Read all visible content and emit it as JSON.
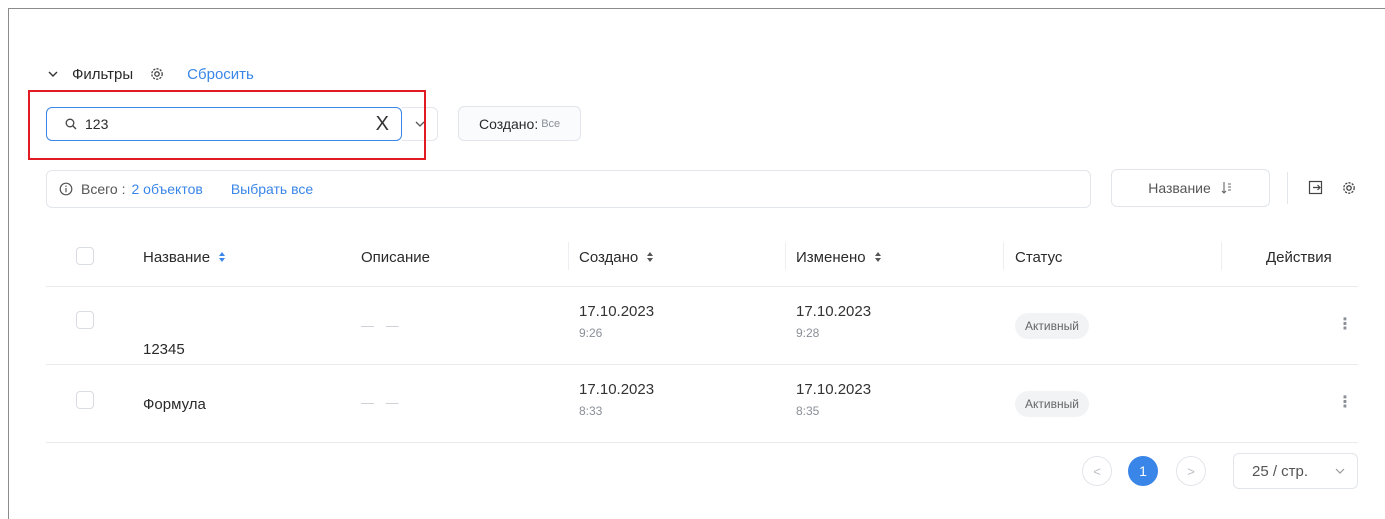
{
  "filters": {
    "title": "Фильтры",
    "reset": "Сбросить",
    "search_value": "123",
    "clear_symbol": "X",
    "created_label": "Создано:",
    "created_value": "Все"
  },
  "summary": {
    "total_label": "Всего :",
    "total_count": "2 объектов",
    "select_all": "Выбрать все",
    "sort_label": "Название"
  },
  "table": {
    "columns": [
      "Название",
      "Описание",
      "Создано",
      "Изменено",
      "Статус",
      "Действия"
    ],
    "rows": [
      {
        "name": "12345",
        "description": "— —",
        "created_date": "17.10.2023",
        "created_time": "9:26",
        "modified_date": "17.10.2023",
        "modified_time": "9:28",
        "status": "Активный"
      },
      {
        "name": "Формула",
        "description": "— —",
        "created_date": "17.10.2023",
        "created_time": "8:33",
        "modified_date": "17.10.2023",
        "modified_time": "8:35",
        "status": "Активный"
      }
    ]
  },
  "pagination": {
    "prev": "<",
    "current": "1",
    "next": ">",
    "page_size": "25 / стр."
  },
  "colors": {
    "accent": "#3a86e8",
    "highlight_box": "#e01b24"
  }
}
